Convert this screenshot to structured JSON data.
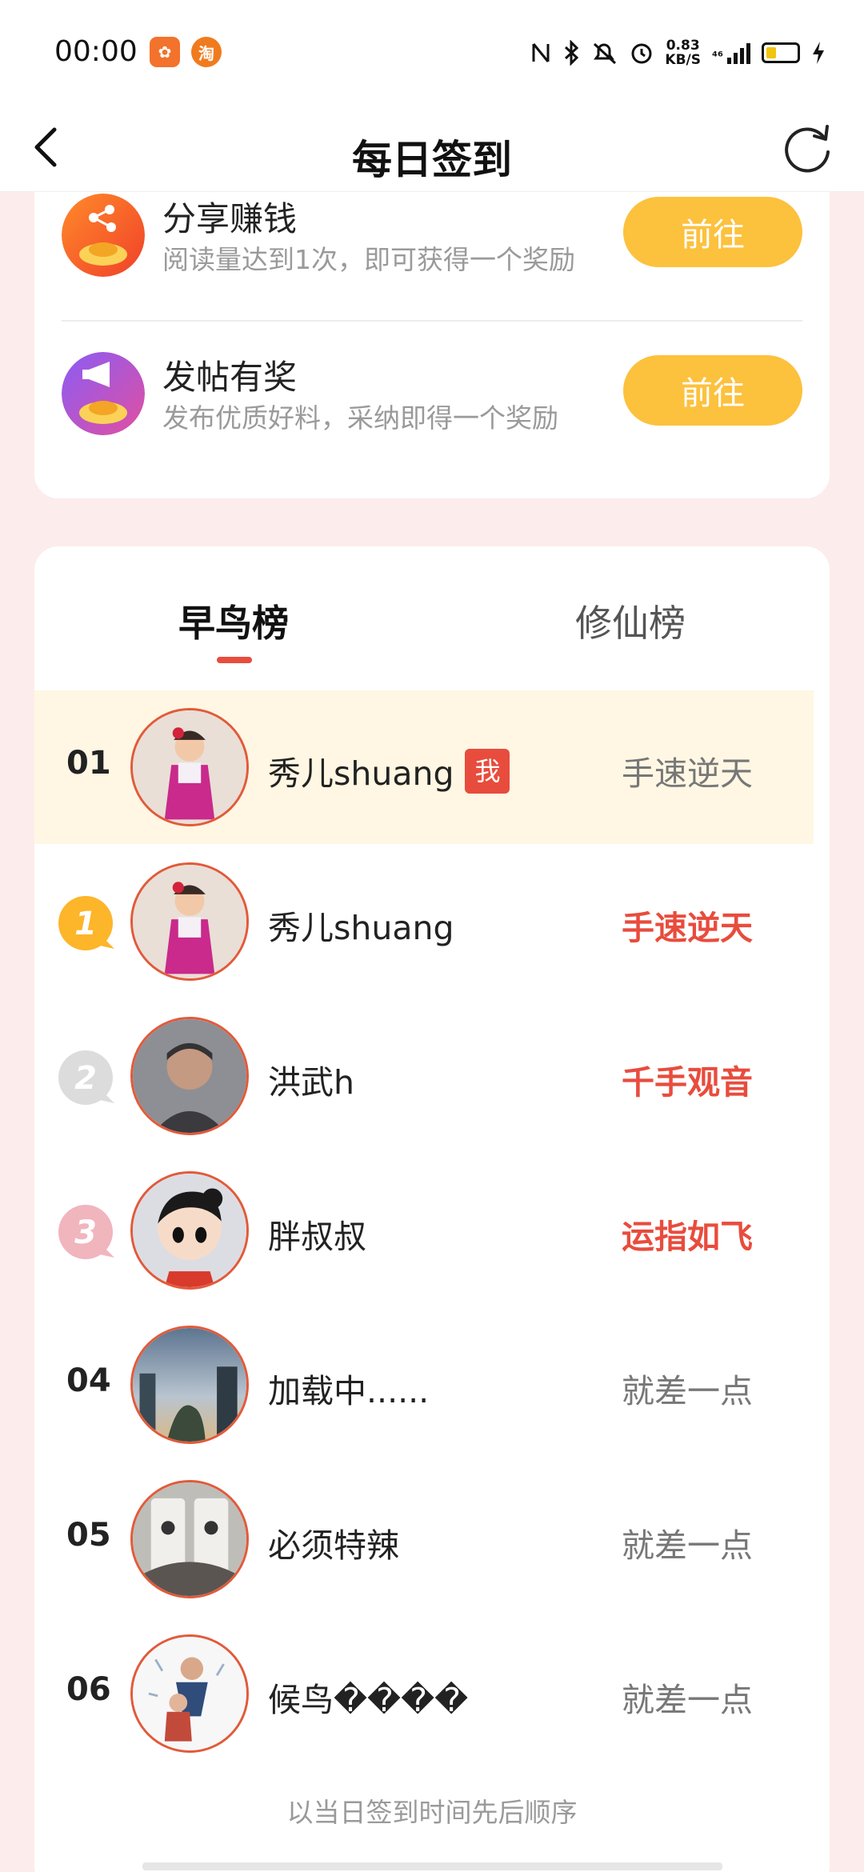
{
  "status_bar": {
    "time": "00:00",
    "app1_glyph": "✿",
    "app2_glyph": "淘",
    "network_speed_value": "0.83",
    "network_speed_unit": "KB/S",
    "network_type": "⁴⁶",
    "icons": [
      "nfc-icon",
      "bluetooth-icon",
      "mute-icon",
      "alarm-icon",
      "signal-icon",
      "battery-icon",
      "charging-icon"
    ]
  },
  "nav": {
    "title": "每日签到"
  },
  "tasks": [
    {
      "title": "分享赚钱",
      "desc": "阅读量达到1次，即可获得一个奖励",
      "button": "前往",
      "icon": "share-money-icon",
      "icon_color": "#f35a2a"
    },
    {
      "title": "发帖有奖",
      "desc": "发布优质好料，采纳即得一个奖励",
      "button": "前往",
      "icon": "post-reward-icon",
      "icon_color": "#b94be6"
    }
  ],
  "tabs": [
    {
      "label": "早鸟榜",
      "active": true
    },
    {
      "label": "修仙榜",
      "active": false
    }
  ],
  "ranking": [
    {
      "rank": "01",
      "name": "秀儿shuang",
      "tag": "手速逆天",
      "is_self": true,
      "me_label": "我",
      "tag_highlight": false
    },
    {
      "rank": "1",
      "name": "秀儿shuang",
      "tag": "手速逆天",
      "medal": "gold",
      "tag_highlight": true
    },
    {
      "rank": "2",
      "name": "洪武h",
      "tag": "千手观音",
      "medal": "silver",
      "tag_highlight": true
    },
    {
      "rank": "3",
      "name": "胖叔叔",
      "tag": "运指如飞",
      "medal": "bronze",
      "tag_highlight": true
    },
    {
      "rank": "04",
      "name": "加载中......",
      "tag": "就差一点",
      "tag_highlight": false
    },
    {
      "rank": "05",
      "name": "必须特辣",
      "tag": "就差一点",
      "tag_highlight": false
    },
    {
      "rank": "06",
      "name": "候鸟����",
      "tag": "就差一点",
      "tag_highlight": false
    }
  ],
  "footer_note": "以当日签到时间先后顺序",
  "colors": {
    "accent_red": "#e84c3d",
    "button_yellow": "#fcc13d",
    "self_row_bg": "#fff7e3",
    "page_bg": "#fdecec"
  }
}
